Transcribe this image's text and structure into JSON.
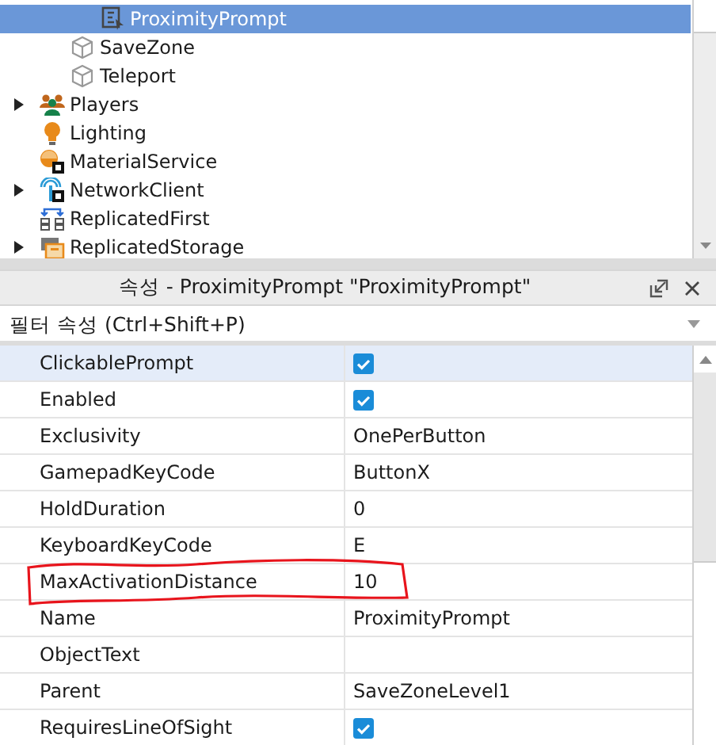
{
  "explorer": {
    "items": [
      {
        "children": [
          {
            "children": [
              {
                "label": "ProximityPrompt",
                "kind": "prompt",
                "selected": true
              }
            ]
          },
          {
            "label": "SaveZone",
            "kind": "part",
            "selected": false
          },
          {
            "label": "Teleport",
            "kind": "part",
            "selected": false
          }
        ]
      },
      {
        "label": "Players",
        "kind": "players",
        "selected": false,
        "expanded": false
      },
      {
        "label": "Lighting",
        "kind": "lighting",
        "selected": false
      },
      {
        "label": "MaterialService",
        "kind": "material",
        "selected": false
      },
      {
        "label": "NetworkClient",
        "kind": "network",
        "selected": false,
        "expanded": false
      },
      {
        "label": "ReplicatedFirst",
        "kind": "first",
        "selected": false
      },
      {
        "label": "ReplicatedStorage",
        "kind": "storage",
        "selected": false,
        "expanded": false
      }
    ]
  },
  "properties": {
    "title": "속성 - ProximityPrompt \"ProximityPrompt\"",
    "filter": {
      "placeholder": "필터 속성 (Ctrl+Shift+P)"
    },
    "rows": [
      {
        "name": "ClickablePrompt",
        "kind": "checkbox",
        "checked": true,
        "selected": true
      },
      {
        "name": "Enabled",
        "kind": "checkbox",
        "checked": true,
        "selected": false
      },
      {
        "name": "Exclusivity",
        "kind": "text",
        "value": "OnePerButton",
        "selected": false
      },
      {
        "name": "GamepadKeyCode",
        "kind": "text",
        "value": "ButtonX",
        "selected": false
      },
      {
        "name": "HoldDuration",
        "kind": "text",
        "value": "0",
        "selected": false
      },
      {
        "name": "KeyboardKeyCode",
        "kind": "text",
        "value": "E",
        "selected": false
      },
      {
        "name": "MaxActivationDistance",
        "kind": "text",
        "value": "10",
        "selected": false,
        "circled": true
      },
      {
        "name": "Name",
        "kind": "text",
        "value": "ProximityPrompt",
        "selected": false
      },
      {
        "name": "ObjectText",
        "kind": "text",
        "selected": false
      },
      {
        "name": "Parent",
        "kind": "text",
        "value": "SaveZoneLevel1",
        "selected": false
      },
      {
        "name": "RequiresLineOfSight",
        "kind": "checkbox",
        "checked": true,
        "selected": false
      }
    ]
  }
}
